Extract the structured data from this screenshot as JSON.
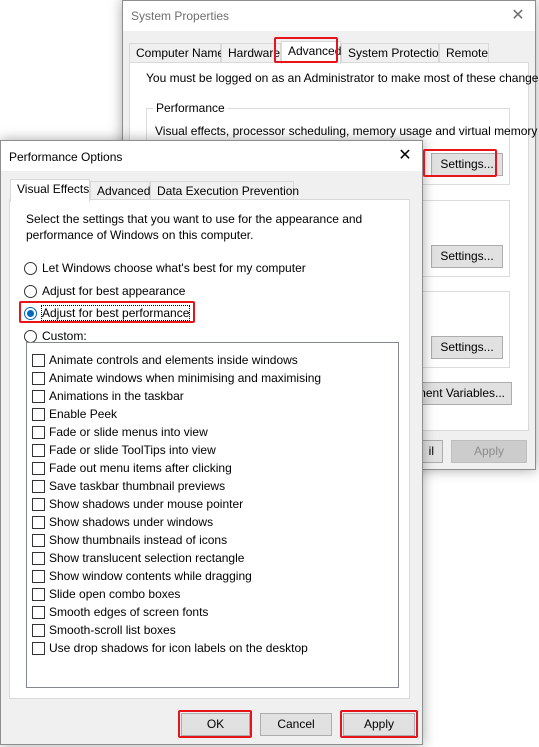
{
  "system_properties": {
    "title": "System Properties",
    "tabs": [
      "Computer Name",
      "Hardware",
      "Advanced",
      "System Protection",
      "Remote"
    ],
    "active_tab": "Advanced",
    "admin_note": "You must be logged on as an Administrator to make most of these changes.",
    "performance_group": {
      "label": "Performance",
      "description": "Visual effects, processor scheduling, memory usage and virtual memory",
      "settings_label": "Settings..."
    },
    "user_profiles_settings_label": "Settings...",
    "startup_settings_label": "Settings...",
    "env_vars_label": "ment Variables...",
    "ok_partial_label": "il",
    "apply_label": "Apply"
  },
  "performance_options": {
    "title": "Performance Options",
    "tabs": [
      "Visual Effects",
      "Advanced",
      "Data Execution Prevention"
    ],
    "active_tab": "Visual Effects",
    "intro": "Select the settings that you want to use for the appearance and performance of Windows on this computer.",
    "radios": [
      {
        "label": "Let Windows choose what's best for my computer",
        "checked": false
      },
      {
        "label": "Adjust for best appearance",
        "checked": false
      },
      {
        "label": "Adjust for best performance",
        "checked": true
      },
      {
        "label": "Custom:",
        "checked": false
      }
    ],
    "effects": [
      "Animate controls and elements inside windows",
      "Animate windows when minimising and maximising",
      "Animations in the taskbar",
      "Enable Peek",
      "Fade or slide menus into view",
      "Fade or slide ToolTips into view",
      "Fade out menu items after clicking",
      "Save taskbar thumbnail previews",
      "Show shadows under mouse pointer",
      "Show shadows under windows",
      "Show thumbnails instead of icons",
      "Show translucent selection rectangle",
      "Show window contents while dragging",
      "Slide open combo boxes",
      "Smooth edges of screen fonts",
      "Smooth-scroll list boxes",
      "Use drop shadows for icon labels on the desktop"
    ],
    "buttons": {
      "ok": "OK",
      "cancel": "Cancel",
      "apply": "Apply"
    }
  },
  "colors": {
    "highlight": "#e8141b",
    "accent": "#0067c0"
  }
}
